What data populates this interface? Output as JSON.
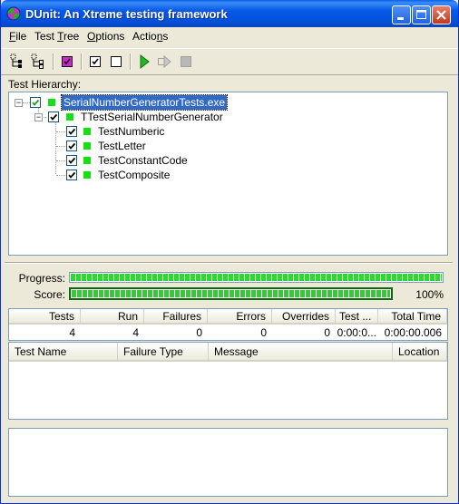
{
  "window": {
    "title": "DUnit: An Xtreme testing framework",
    "accent": "#0558e6"
  },
  "menu": {
    "file": {
      "mnemonic": "F",
      "rest": "ile"
    },
    "test_tree": {
      "before": "Test ",
      "mnemonic": "T",
      "rest": "ree"
    },
    "options": {
      "mnemonic": "O",
      "rest": "ptions"
    },
    "actions": {
      "before": "Actio",
      "mnemonic": "n",
      "rest": "s"
    }
  },
  "toolbar": {
    "icons": [
      "select-all-icon",
      "deselect-all-icon",
      "select-failed-icon",
      "check-all-icon",
      "uncheck-all-icon",
      "run-icon",
      "run-selected-icon",
      "stop-icon"
    ]
  },
  "tree": {
    "label": "Test Hierarchy:",
    "root": {
      "label": "SerialNumberGeneratorTests.exe",
      "checked": true,
      "status_color": "#14e014"
    },
    "suite": {
      "label": "TTestSerialNumberGenerator",
      "checked": true
    },
    "tests": [
      {
        "label": "TestNumberic",
        "checked": true
      },
      {
        "label": "TestLetter",
        "checked": true
      },
      {
        "label": "TestConstantCode",
        "checked": true
      },
      {
        "label": "TestComposite",
        "checked": true
      }
    ]
  },
  "progress": {
    "label": "Progress:",
    "value": 1.0
  },
  "score": {
    "label": "Score:",
    "value": 1.0,
    "percent_text": "100%"
  },
  "stats": {
    "headers": [
      "Tests",
      "Run",
      "Failures",
      "Errors",
      "Overrides",
      "Test ...",
      "Total Time"
    ],
    "values": [
      "4",
      "4",
      "0",
      "0",
      "0",
      "0:00:0...",
      "0:00:00.006"
    ]
  },
  "failures": {
    "headers": [
      "Test Name",
      "Failure Type",
      "Message",
      "Location"
    ]
  }
}
